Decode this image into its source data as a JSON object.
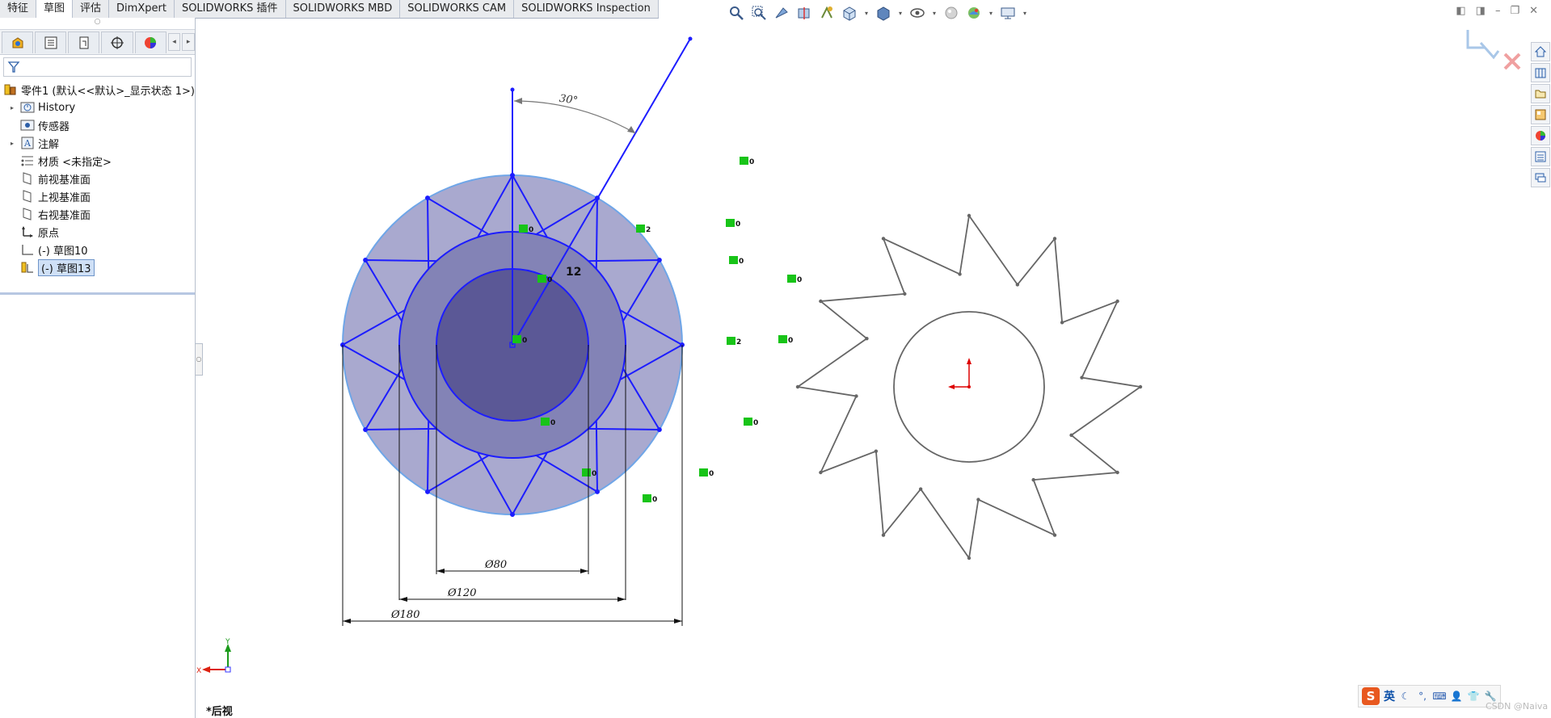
{
  "tabs": [
    {
      "label": "特征",
      "active": false
    },
    {
      "label": "草图",
      "active": true
    },
    {
      "label": "评估",
      "active": false
    },
    {
      "label": "DimXpert",
      "active": false
    },
    {
      "label": "SOLIDWORKS 插件",
      "active": false
    },
    {
      "label": "SOLIDWORKS MBD",
      "active": false
    },
    {
      "label": "SOLIDWORKS CAM",
      "active": false
    },
    {
      "label": "SOLIDWORKS Inspection",
      "active": false
    }
  ],
  "toolbar_icons": [
    "zoom-to-fit-icon",
    "zoom-area-icon",
    "previous-view-icon",
    "section-view-icon",
    "dynamic-annotation-icon",
    "view-orientation-icon",
    "display-style-icon",
    "hide-show-icon",
    "edit-appearance-icon",
    "apply-scene-icon",
    "view-settings-icon"
  ],
  "panel_tabs": [
    "feature-manager-icon",
    "property-manager-icon",
    "configuration-manager-icon",
    "dimxpert-manager-icon",
    "display-manager-icon"
  ],
  "tree": {
    "root": "零件1 (默认<<默认>_显示状态 1>)",
    "items": [
      {
        "label": "History",
        "icon": "history-icon",
        "expandable": true
      },
      {
        "label": "传感器",
        "icon": "sensor-icon",
        "expandable": false
      },
      {
        "label": "注解",
        "icon": "annotation-icon",
        "expandable": true
      },
      {
        "label": "材质 <未指定>",
        "icon": "material-icon",
        "expandable": false
      },
      {
        "label": "前视基准面",
        "icon": "plane-icon",
        "expandable": false
      },
      {
        "label": "上视基准面",
        "icon": "plane-icon",
        "expandable": false
      },
      {
        "label": "右视基准面",
        "icon": "plane-icon",
        "expandable": false
      },
      {
        "label": "原点",
        "icon": "origin-icon",
        "expandable": false
      },
      {
        "label": "(-) 草图10",
        "icon": "sketch-icon",
        "expandable": false
      },
      {
        "label": "(-) 草图13",
        "icon": "sketch-edit-icon",
        "expandable": false,
        "selected": true
      }
    ]
  },
  "dimensions": {
    "angle": "30°",
    "count": "12",
    "d80": "Ø80",
    "d120": "Ø120",
    "d180": "Ø180"
  },
  "relation_markers": [
    "0",
    "0",
    "0",
    "0",
    "0",
    "0",
    "0",
    "0",
    "0",
    "0",
    "0",
    "0",
    "0",
    "2",
    "2"
  ],
  "triad": {
    "x": "X",
    "y": "Y"
  },
  "view_label": "*后视",
  "ime": {
    "lang": "英"
  },
  "watermark": "CSDN @Naiva",
  "colors": {
    "sketch": "#1d1dff",
    "fill_outer": "#a9a9cf",
    "fill_mid": "#8383b6",
    "fill_inner": "#5b5896",
    "relation": "#18c418",
    "preview": "#666666"
  }
}
